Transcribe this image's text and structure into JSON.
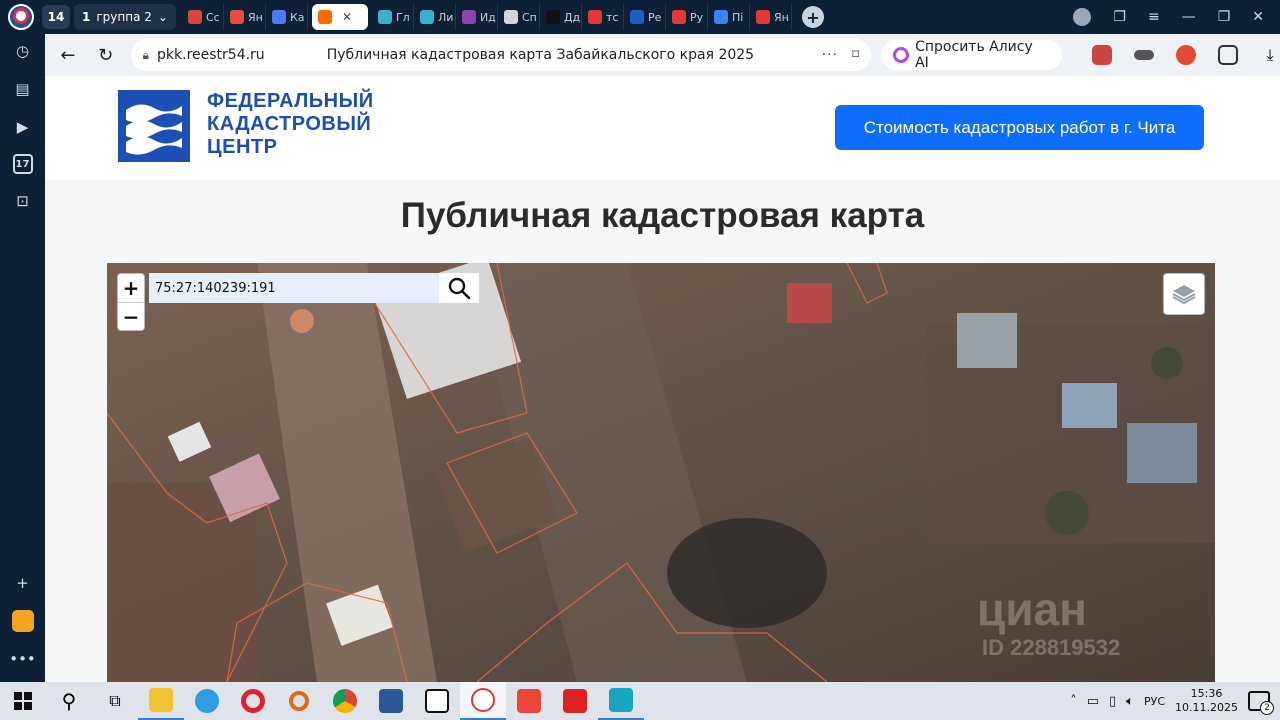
{
  "browser": {
    "tab_count": "14",
    "group_tab": {
      "number": "1",
      "label": "группа 2"
    },
    "tabs": [
      {
        "label": "Сс",
        "color": "#d9443b"
      },
      {
        "label": "Ян",
        "color": "#e94b3c"
      },
      {
        "label": "Ка",
        "color": "#4a7bff"
      },
      {
        "label": "",
        "color": "#ff6a00",
        "active": true
      },
      {
        "label": "Гл",
        "color": "#3ab0c8"
      },
      {
        "label": "Ли",
        "color": "#3ab0c8"
      },
      {
        "label": "Ид",
        "color": "#8e44ad"
      },
      {
        "label": "Сп",
        "color": "#cfd6de"
      },
      {
        "label": "Дд",
        "color": "#111111"
      },
      {
        "label": "тс",
        "color": "#e53935"
      },
      {
        "label": "Ре",
        "color": "#1e5ec8"
      },
      {
        "label": "Ру",
        "color": "#e53935"
      },
      {
        "label": "Пі",
        "color": "#3b82f6"
      },
      {
        "label": "Ян",
        "color": "#e53935"
      }
    ],
    "active_tab_close": "✕",
    "new_tab": "+",
    "url": "pkk.reestr54.ru",
    "page_title": "Публичная кадастровая карта Забайкальского края 2025",
    "more": "···",
    "alice_label": "Спросить Алису AI"
  },
  "site": {
    "logo_lines": [
      "ФЕДЕРАЛЬНЫЙ",
      "КАДАСТРОВЫЙ",
      "ЦЕНТР"
    ],
    "cta_label": "Стоимость кадастровых работ в г. Чита",
    "heading": "Публичная кадастровая карта",
    "colors": {
      "brand": "#1b4fb3",
      "cta": "#0d6efd"
    }
  },
  "map": {
    "search_value": "75:27:140239:191",
    "zoom_in": "+",
    "zoom_out": "−",
    "watermark": "циан",
    "watermark_id": "ID 228819532"
  },
  "taskbar": {
    "lang": "РУС",
    "time": "15:36",
    "date": "10.11.2025",
    "notifications": "2"
  }
}
